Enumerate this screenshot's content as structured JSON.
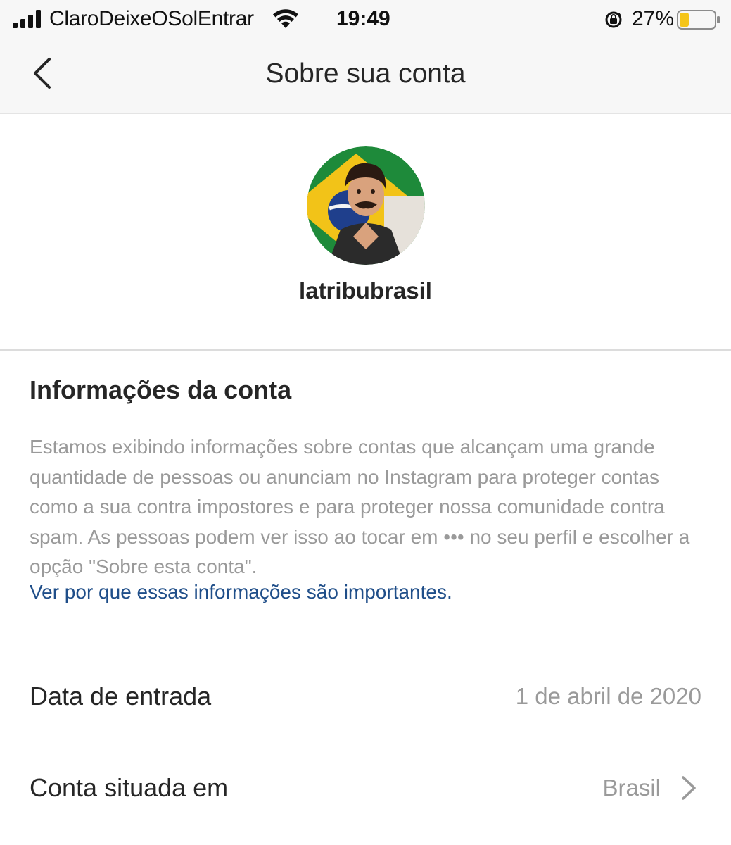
{
  "status_bar": {
    "carrier": "ClaroDeixeOSolEntrar",
    "time": "19:49",
    "battery_percent": "27%",
    "battery_level": 0.27
  },
  "nav": {
    "title": "Sobre sua conta",
    "back_icon": "chevron-left-icon"
  },
  "profile": {
    "username": "latribubrasil"
  },
  "account_info": {
    "title": "Informações da conta",
    "description": "Estamos exibindo informações sobre contas que alcançam uma grande quantidade de pessoas ou anunciam no Instagram para proteger contas como a sua contra impostores e para proteger nossa comunidade contra spam. As pessoas podem ver isso ao tocar em ••• no seu perfil e escolher a opção \"Sobre esta conta\".",
    "link": "Ver por que essas informações são importantes."
  },
  "rows": [
    {
      "label": "Data de entrada",
      "value": "1 de abril de 2020"
    },
    {
      "label": "Conta situada em",
      "value": "Brasil"
    }
  ],
  "colors": {
    "link": "#1f4e89",
    "muted_text": "#9a9a9a",
    "battery_fill": "#f5c518",
    "flag_green": "#1e8a3a",
    "flag_yellow": "#f2c318"
  }
}
